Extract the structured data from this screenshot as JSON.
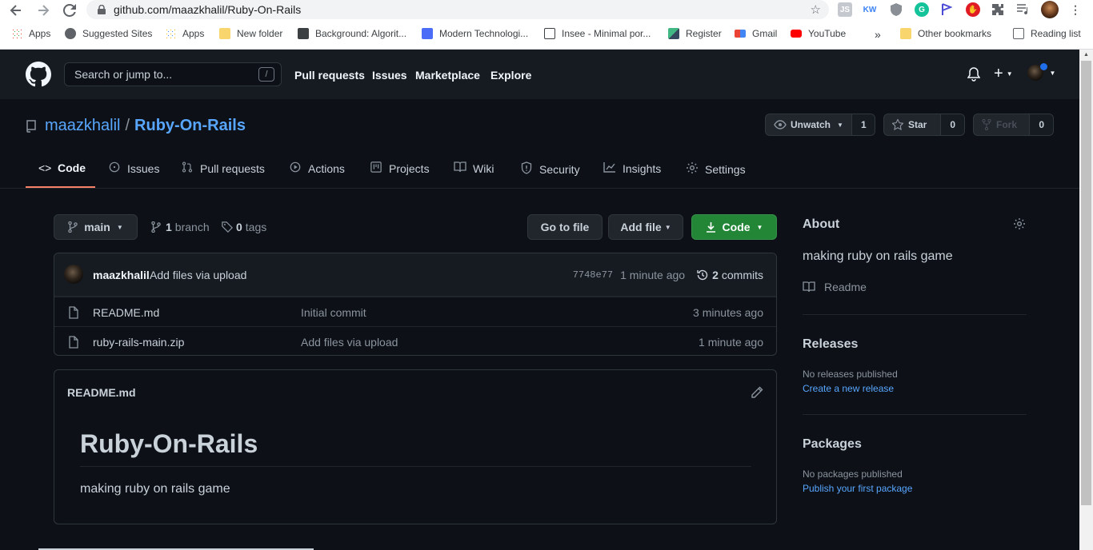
{
  "browser": {
    "url": "github.com/maazkhalil/Ruby-On-Rails",
    "extensions": [
      "JS",
      "KW"
    ],
    "bookmarks": [
      "Apps",
      "Suggested Sites",
      "Apps",
      "New folder",
      "Background: Algorit...",
      "Modern Technologi...",
      "Insee - Minimal por...",
      "Register",
      "Gmail",
      "YouTube"
    ],
    "bookmarks_overflow": "»",
    "other_bookmarks": "Other bookmarks",
    "reading_list": "Reading list"
  },
  "header": {
    "search_placeholder": "Search or jump to...",
    "search_key": "/",
    "nav": [
      "Pull requests",
      "Issues",
      "Marketplace",
      "Explore"
    ]
  },
  "repo": {
    "owner": "maazkhalil",
    "separator": "/",
    "name": "Ruby-On-Rails",
    "watch_label": "Unwatch",
    "watch_count": "1",
    "star_label": "Star",
    "star_count": "0",
    "fork_label": "Fork",
    "fork_count": "0",
    "tabs": [
      "Code",
      "Issues",
      "Pull requests",
      "Actions",
      "Projects",
      "Wiki",
      "Security",
      "Insights",
      "Settings"
    ],
    "active_tab": "Code"
  },
  "files_nav": {
    "branch": "main",
    "branch_count": "1",
    "branch_label": "branch",
    "tag_count": "0",
    "tag_label": "tags",
    "go_to_file": "Go to file",
    "add_file": "Add file",
    "code": "Code"
  },
  "commit": {
    "author": "maazkhalil",
    "message": "Add files via upload",
    "sha": "7748e77",
    "age": "1 minute ago",
    "commit_count": "2",
    "commit_label": "commits"
  },
  "files": [
    {
      "name": "README.md",
      "message": "Initial commit",
      "age": "3 minutes ago"
    },
    {
      "name": "ruby-rails-main.zip",
      "message": "Add files via upload",
      "age": "1 minute ago"
    }
  ],
  "readme": {
    "filename": "README.md",
    "heading": "Ruby-On-Rails",
    "body": "making ruby on rails game"
  },
  "sidebar": {
    "about_title": "About",
    "description": "making ruby on rails game",
    "readme_link": "Readme",
    "releases_title": "Releases",
    "releases_none": "No releases published",
    "releases_link": "Create a new release",
    "packages_title": "Packages",
    "packages_none": "No packages published",
    "packages_link": "Publish your first package"
  },
  "colors": {
    "background": "#0d1117",
    "header": "#161b22",
    "link": "#58a6ff",
    "green_button": "#238636",
    "tab_underline": "#f78166"
  }
}
